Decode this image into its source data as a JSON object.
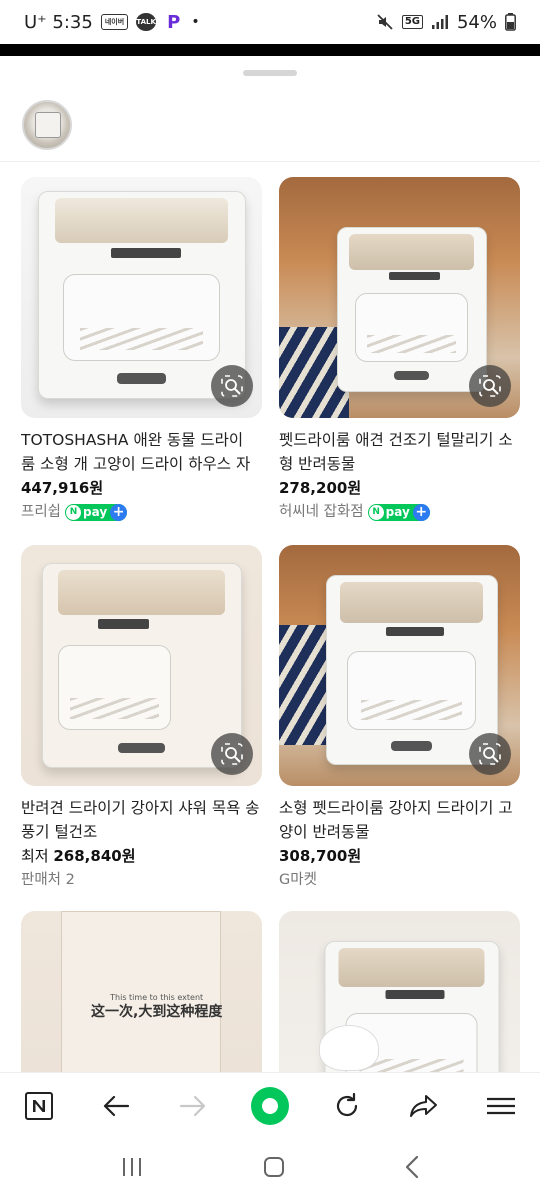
{
  "status": {
    "carrier": "U⁺ 5:35",
    "mini_icons": [
      "네이버",
      "TALK",
      "P"
    ],
    "network": "5G",
    "battery": "54%",
    "colors": {
      "p_app": "#6a2cd8"
    }
  },
  "products": [
    {
      "title": "TOTOSHASHA 애완 동물 드라이 룸 소형 개 고양이 드라이 하우스 자동 ...",
      "price_prefix": "",
      "price": "447,916원",
      "seller": "프리쉽",
      "npay": true,
      "image": "white"
    },
    {
      "title": "펫드라이룸 애견 건조기 털말리기 소형 반려동물",
      "price_prefix": "",
      "price": "278,200원",
      "seller": "허씨네 잡화점",
      "npay": true,
      "image": "room"
    },
    {
      "title": "반려견 드라이기 강아지 샤워 목욕 송풍기 털건조",
      "price_prefix": "최저 ",
      "price": "268,840원",
      "seller": "판매처 2",
      "npay": false,
      "image": "cream"
    },
    {
      "title": "소형 펫드라이룸 강아지 드라이기 고양이 반려동물",
      "price_prefix": "",
      "price": "308,700원",
      "seller": "G마켓",
      "npay": false,
      "image": "room"
    }
  ],
  "partial_products": [
    {
      "image": "cream",
      "overlay_heading": "这一次,大到这种程度",
      "overlay_small": "This time to this extent"
    },
    {
      "image": "beige"
    }
  ],
  "npay_label": "pay",
  "npay_colors": {
    "green": "#03c75a",
    "plus": "#2d7bf0"
  },
  "bottom_nav": [
    "naver-home-icon",
    "back-arrow-icon",
    "forward-arrow-icon",
    "green-dot-icon",
    "refresh-icon",
    "share-icon",
    "menu-icon"
  ],
  "system_nav": [
    "recents-icon",
    "home-icon",
    "back-icon"
  ]
}
